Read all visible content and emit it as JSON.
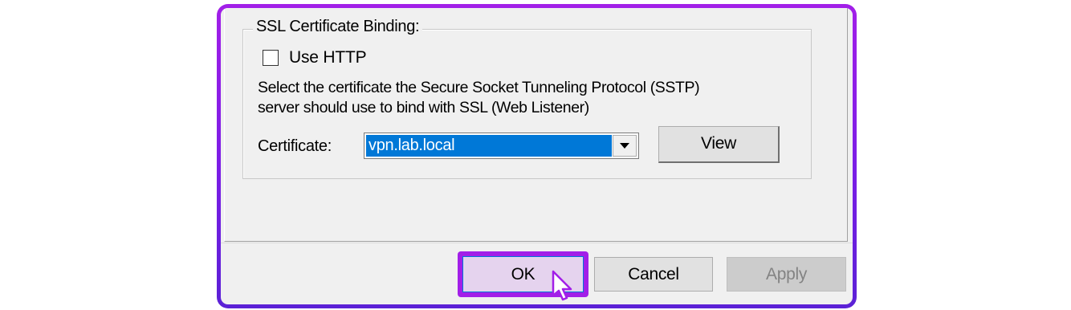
{
  "group": {
    "title": "SSL Certificate Binding:",
    "use_http_label": "Use HTTP",
    "use_http_checked": false,
    "description_line1": "Select the certificate the Secure Socket Tunneling Protocol (SSTP)",
    "description_line2": "server should use to bind with SSL (Web Listener)",
    "certificate_label": "Certificate:",
    "certificate_value": "vpn.lab.local",
    "view_label": "View"
  },
  "footer": {
    "ok_label": "OK",
    "cancel_label": "Cancel",
    "apply_label": "Apply"
  },
  "colors": {
    "highlight_border": "#a21fe8",
    "selection": "#0078d7"
  },
  "icons": {
    "dropdown": "chevron-down-icon",
    "cursor": "mouse-pointer-icon"
  }
}
